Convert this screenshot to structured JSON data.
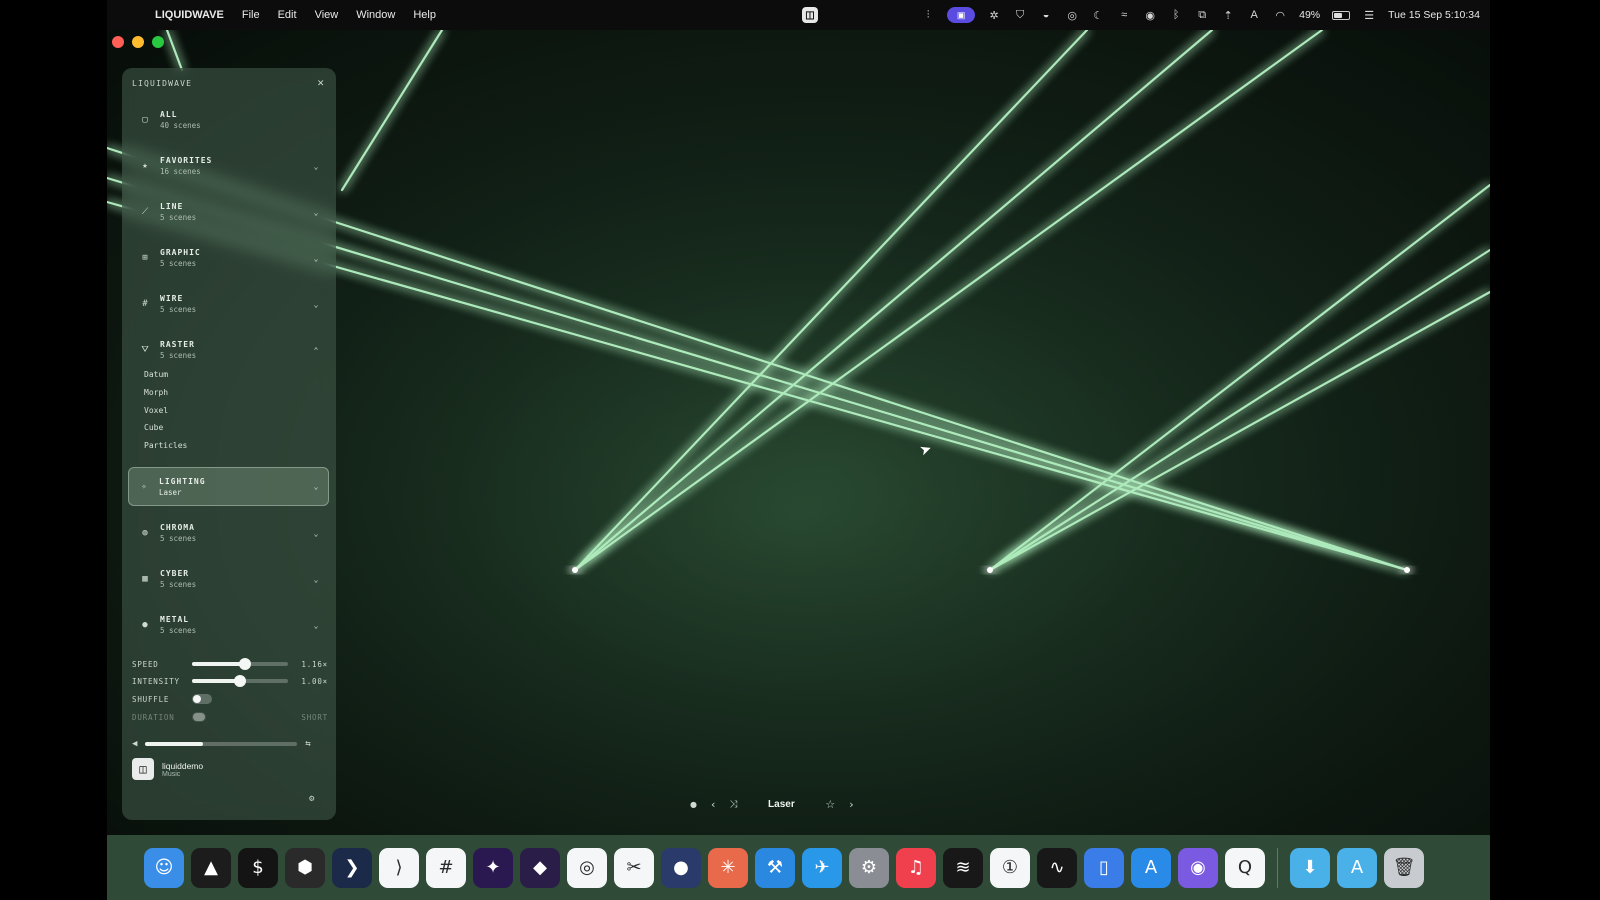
{
  "menubar": {
    "app_name": "LIQUIDWAVE",
    "menus": [
      "File",
      "Edit",
      "View",
      "Window",
      "Help"
    ],
    "battery": "49%",
    "clock": "Tue 15 Sep  5:10:34"
  },
  "sidebar": {
    "title": "LIQUIDWAVE",
    "categories": [
      {
        "label": "ALL",
        "sub": "40 scenes",
        "icon": "folder-icon",
        "chevron": ""
      },
      {
        "label": "FAVORITES",
        "sub": "16 scenes",
        "icon": "star-icon",
        "chevron": "⌄"
      },
      {
        "label": "LINE",
        "sub": "5 scenes",
        "icon": "line-icon",
        "chevron": "⌄"
      },
      {
        "label": "GRAPHIC",
        "sub": "5 scenes",
        "icon": "graphic-icon",
        "chevron": "⌄"
      },
      {
        "label": "WIRE",
        "sub": "5 scenes",
        "icon": "wire-icon",
        "chevron": "⌄"
      },
      {
        "label": "RASTER",
        "sub": "5 scenes",
        "icon": "raster-icon",
        "chevron": "⌃"
      },
      {
        "label": "LIGHTING",
        "sub": "Laser",
        "icon": "light-icon",
        "chevron": "⌄"
      },
      {
        "label": "CHROMA",
        "sub": "5 scenes",
        "icon": "chroma-icon",
        "chevron": "⌄"
      },
      {
        "label": "CYBER",
        "sub": "5 scenes",
        "icon": "cyber-icon",
        "chevron": "⌄"
      },
      {
        "label": "METAL",
        "sub": "5 scenes",
        "icon": "metal-icon",
        "chevron": "⌄"
      }
    ],
    "raster_items": [
      "Datum",
      "Morph",
      "Voxel",
      "Cube",
      "Particles"
    ],
    "controls": {
      "speed_label": "SPEED",
      "speed_value": "1.16×",
      "speed_level": 0.55,
      "intensity_label": "INTENSITY",
      "intensity_value": "1.00×",
      "intensity_level": 0.5,
      "shuffle_label": "SHUFFLE",
      "duration_label": "DURATION",
      "duration_value": "SHORT"
    },
    "volume_level": 0.38,
    "track": {
      "title": "liquiddemo",
      "sub": "Music"
    }
  },
  "player": {
    "scene": "Laser"
  },
  "dock": {
    "apps": [
      {
        "name": "finder-icon",
        "color": "#3a8ee8",
        "glyph": "☺"
      },
      {
        "name": "terminal-green-icon",
        "color": "#1c1c1c",
        "glyph": "▲"
      },
      {
        "name": "terminal-icon",
        "color": "#141414",
        "glyph": "$"
      },
      {
        "name": "cube-app-icon",
        "color": "#2a2a2a",
        "glyph": "⬢"
      },
      {
        "name": "prompt-app-icon",
        "color": "#1a2a48",
        "glyph": "❯"
      },
      {
        "name": "vscode-icon",
        "color": "#f4f6f8",
        "glyph": "⟩"
      },
      {
        "name": "slack-icon",
        "color": "#f4f6f8",
        "glyph": "#"
      },
      {
        "name": "ai-app-icon",
        "color": "#2a1850",
        "glyph": "✦"
      },
      {
        "name": "obsidian-icon",
        "color": "#2a1e48",
        "glyph": "◆"
      },
      {
        "name": "chrome-icon",
        "color": "#f4f6f8",
        "glyph": "◎"
      },
      {
        "name": "capcut-icon",
        "color": "#f4f6f8",
        "glyph": "✂"
      },
      {
        "name": "chat-app-icon",
        "color": "#2a3a6a",
        "glyph": "●"
      },
      {
        "name": "claude-icon",
        "color": "#e86a4a",
        "glyph": "✳"
      },
      {
        "name": "xcode-icon",
        "color": "#2a88e0",
        "glyph": "⚒"
      },
      {
        "name": "testflight-icon",
        "color": "#2a98e8",
        "glyph": "✈"
      },
      {
        "name": "settings-icon",
        "color": "#8a8e94",
        "glyph": "⚙"
      },
      {
        "name": "music-icon",
        "color": "#f0404e",
        "glyph": "♫"
      },
      {
        "name": "spotify-icon",
        "color": "#181818",
        "glyph": "≋"
      },
      {
        "name": "1password-icon",
        "color": "#f4f6f8",
        "glyph": "①"
      },
      {
        "name": "activity-icon",
        "color": "#181818",
        "glyph": "∿"
      },
      {
        "name": "simulator-icon",
        "color": "#3a7ce8",
        "glyph": "▯"
      },
      {
        "name": "app-store-icon",
        "color": "#2a8ae8",
        "glyph": "A"
      },
      {
        "name": "podcast-app-icon",
        "color": "#7a5ae0",
        "glyph": "◉"
      },
      {
        "name": "qsync-icon",
        "color": "#f4f6f8",
        "glyph": "Q"
      }
    ],
    "folders": [
      {
        "name": "downloads-folder-icon",
        "color": "#4ab0e8",
        "glyph": "⬇"
      },
      {
        "name": "apps-folder-icon",
        "color": "#4ab0e8",
        "glyph": "A"
      },
      {
        "name": "trash-icon",
        "color": "#c8ccd0",
        "glyph": "🗑"
      }
    ]
  }
}
